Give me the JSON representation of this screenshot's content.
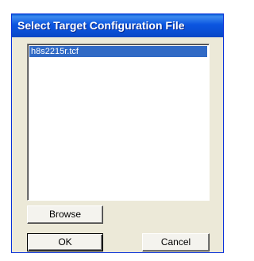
{
  "dialog": {
    "title": "Select Target Configuration File"
  },
  "file_list": {
    "items": [
      "h8s2215r.tcf"
    ],
    "selected_index": 0
  },
  "buttons": {
    "browse_label": "Browse",
    "ok_label": "OK",
    "cancel_label": "Cancel"
  },
  "colors": {
    "titlebar": "#0a4ed4",
    "selection": "#316ac5",
    "dialog_bg": "#ece9d8"
  }
}
